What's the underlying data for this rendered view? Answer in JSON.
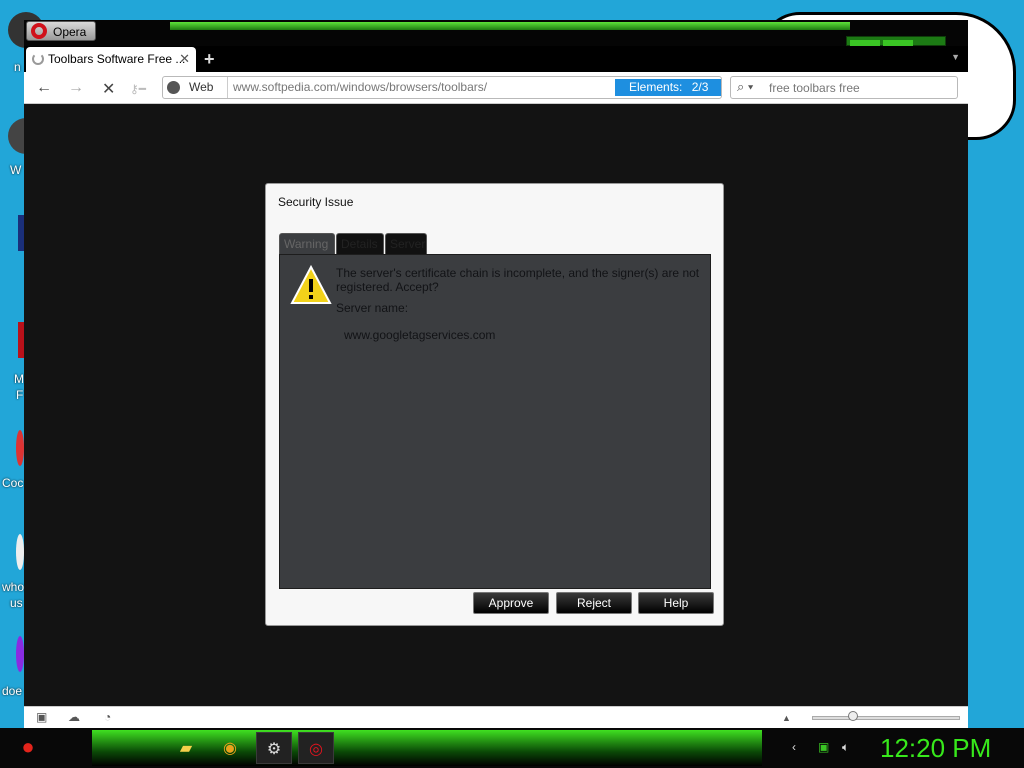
{
  "desktop": {
    "labels": [
      "n",
      "W",
      "M",
      "F",
      "Coc",
      "who",
      "us",
      "doe"
    ]
  },
  "browser": {
    "menu_button": "Opera",
    "tab": {
      "title": "Toolbars Software Free ...",
      "close": "✕"
    },
    "new_tab": "+",
    "address": {
      "scope_label": "Web",
      "url": "www.softpedia.com/windows/browsers/toolbars/",
      "elements_label": "Elements:",
      "elements_count": "2/3"
    },
    "search": {
      "placeholder": "free toolbars free"
    }
  },
  "dialog": {
    "title": "Security Issue",
    "tabs": [
      "Warning",
      "Details",
      "Server"
    ],
    "message": "The server's certificate chain is incomplete, and the signer(s) are not registered. Accept?",
    "server_label": "Server name:",
    "server_name": "www.googletagservices.com",
    "buttons": {
      "approve": "Approve",
      "reject": "Reject",
      "help": "Help"
    }
  },
  "taskbar": {
    "clock": "12:20 PM"
  },
  "colors": {
    "accent_green": "#37e81b",
    "desktop_blue": "#22a6d8",
    "dialog_panel": "#3b3d40"
  }
}
